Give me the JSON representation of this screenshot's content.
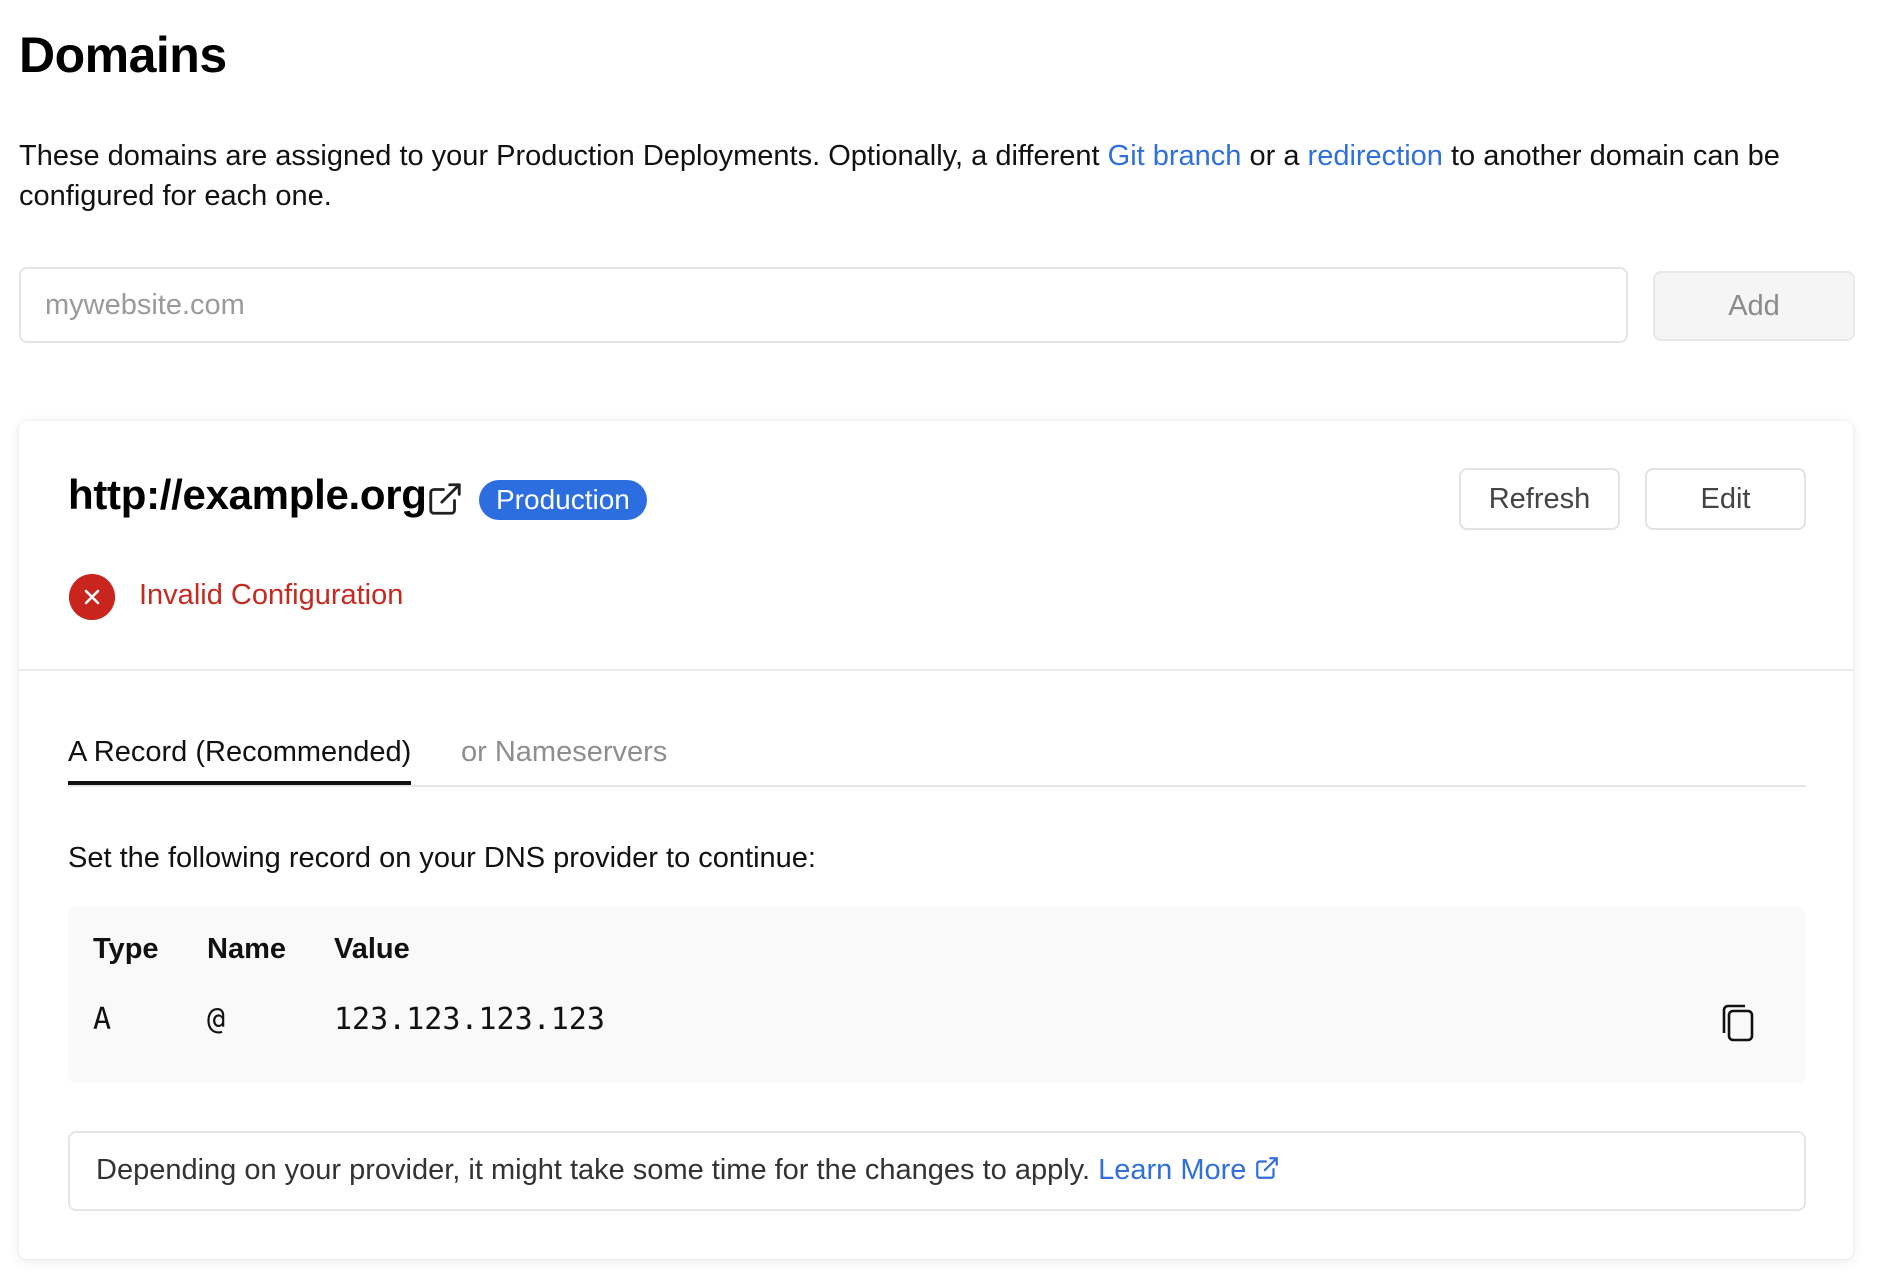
{
  "page": {
    "title": "Domains",
    "intro": {
      "part1": "These domains are assigned to your Production Deployments. Optionally, a different ",
      "link1": "Git branch",
      "part2": " or a ",
      "link2": "redirection",
      "part3": " to another domain can be configured for each one."
    }
  },
  "add_domain": {
    "placeholder": "mywebsite.com",
    "value": "",
    "button_label": "Add"
  },
  "domain_card": {
    "domain": "http://example.org",
    "badge": "Production",
    "refresh_label": "Refresh",
    "edit_label": "Edit",
    "status": {
      "text": "Invalid Configuration",
      "icon": "x-circle-icon",
      "color": "#c9251e"
    },
    "tabs": [
      {
        "label": "A Record (Recommended)",
        "active": true
      },
      {
        "label": "or Nameservers",
        "active": false
      }
    ],
    "instruction": "Set the following record on your DNS provider to continue:",
    "record": {
      "headers": [
        "Type",
        "Name",
        "Value"
      ],
      "row": [
        "A",
        "@",
        "123.123.123.123"
      ],
      "copy_icon": "copy-icon"
    },
    "note": {
      "text": "Depending on your provider, it might take some time for the changes to apply. ",
      "link": "Learn More"
    }
  },
  "colors": {
    "link": "#2f6fde",
    "badge": "#2c6ddf",
    "error": "#c42a20"
  }
}
